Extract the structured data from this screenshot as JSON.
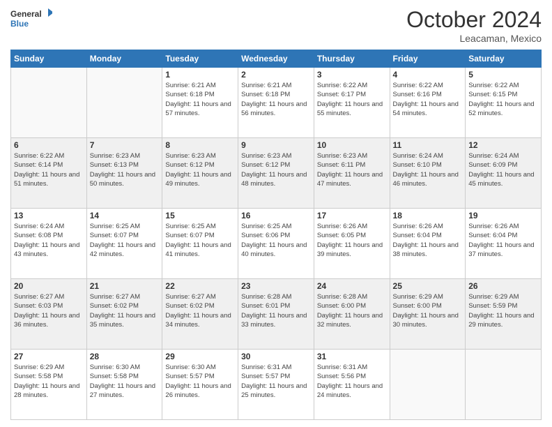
{
  "header": {
    "logo_line1": "General",
    "logo_line2": "Blue",
    "month_title": "October 2024",
    "location": "Leacaman, Mexico"
  },
  "days_of_week": [
    "Sunday",
    "Monday",
    "Tuesday",
    "Wednesday",
    "Thursday",
    "Friday",
    "Saturday"
  ],
  "weeks": [
    [
      {
        "day": "",
        "info": ""
      },
      {
        "day": "",
        "info": ""
      },
      {
        "day": "1",
        "info": "Sunrise: 6:21 AM\nSunset: 6:18 PM\nDaylight: 11 hours and 57 minutes."
      },
      {
        "day": "2",
        "info": "Sunrise: 6:21 AM\nSunset: 6:18 PM\nDaylight: 11 hours and 56 minutes."
      },
      {
        "day": "3",
        "info": "Sunrise: 6:22 AM\nSunset: 6:17 PM\nDaylight: 11 hours and 55 minutes."
      },
      {
        "day": "4",
        "info": "Sunrise: 6:22 AM\nSunset: 6:16 PM\nDaylight: 11 hours and 54 minutes."
      },
      {
        "day": "5",
        "info": "Sunrise: 6:22 AM\nSunset: 6:15 PM\nDaylight: 11 hours and 52 minutes."
      }
    ],
    [
      {
        "day": "6",
        "info": "Sunrise: 6:22 AM\nSunset: 6:14 PM\nDaylight: 11 hours and 51 minutes."
      },
      {
        "day": "7",
        "info": "Sunrise: 6:23 AM\nSunset: 6:13 PM\nDaylight: 11 hours and 50 minutes."
      },
      {
        "day": "8",
        "info": "Sunrise: 6:23 AM\nSunset: 6:12 PM\nDaylight: 11 hours and 49 minutes."
      },
      {
        "day": "9",
        "info": "Sunrise: 6:23 AM\nSunset: 6:12 PM\nDaylight: 11 hours and 48 minutes."
      },
      {
        "day": "10",
        "info": "Sunrise: 6:23 AM\nSunset: 6:11 PM\nDaylight: 11 hours and 47 minutes."
      },
      {
        "day": "11",
        "info": "Sunrise: 6:24 AM\nSunset: 6:10 PM\nDaylight: 11 hours and 46 minutes."
      },
      {
        "day": "12",
        "info": "Sunrise: 6:24 AM\nSunset: 6:09 PM\nDaylight: 11 hours and 45 minutes."
      }
    ],
    [
      {
        "day": "13",
        "info": "Sunrise: 6:24 AM\nSunset: 6:08 PM\nDaylight: 11 hours and 43 minutes."
      },
      {
        "day": "14",
        "info": "Sunrise: 6:25 AM\nSunset: 6:07 PM\nDaylight: 11 hours and 42 minutes."
      },
      {
        "day": "15",
        "info": "Sunrise: 6:25 AM\nSunset: 6:07 PM\nDaylight: 11 hours and 41 minutes."
      },
      {
        "day": "16",
        "info": "Sunrise: 6:25 AM\nSunset: 6:06 PM\nDaylight: 11 hours and 40 minutes."
      },
      {
        "day": "17",
        "info": "Sunrise: 6:26 AM\nSunset: 6:05 PM\nDaylight: 11 hours and 39 minutes."
      },
      {
        "day": "18",
        "info": "Sunrise: 6:26 AM\nSunset: 6:04 PM\nDaylight: 11 hours and 38 minutes."
      },
      {
        "day": "19",
        "info": "Sunrise: 6:26 AM\nSunset: 6:04 PM\nDaylight: 11 hours and 37 minutes."
      }
    ],
    [
      {
        "day": "20",
        "info": "Sunrise: 6:27 AM\nSunset: 6:03 PM\nDaylight: 11 hours and 36 minutes."
      },
      {
        "day": "21",
        "info": "Sunrise: 6:27 AM\nSunset: 6:02 PM\nDaylight: 11 hours and 35 minutes."
      },
      {
        "day": "22",
        "info": "Sunrise: 6:27 AM\nSunset: 6:02 PM\nDaylight: 11 hours and 34 minutes."
      },
      {
        "day": "23",
        "info": "Sunrise: 6:28 AM\nSunset: 6:01 PM\nDaylight: 11 hours and 33 minutes."
      },
      {
        "day": "24",
        "info": "Sunrise: 6:28 AM\nSunset: 6:00 PM\nDaylight: 11 hours and 32 minutes."
      },
      {
        "day": "25",
        "info": "Sunrise: 6:29 AM\nSunset: 6:00 PM\nDaylight: 11 hours and 30 minutes."
      },
      {
        "day": "26",
        "info": "Sunrise: 6:29 AM\nSunset: 5:59 PM\nDaylight: 11 hours and 29 minutes."
      }
    ],
    [
      {
        "day": "27",
        "info": "Sunrise: 6:29 AM\nSunset: 5:58 PM\nDaylight: 11 hours and 28 minutes."
      },
      {
        "day": "28",
        "info": "Sunrise: 6:30 AM\nSunset: 5:58 PM\nDaylight: 11 hours and 27 minutes."
      },
      {
        "day": "29",
        "info": "Sunrise: 6:30 AM\nSunset: 5:57 PM\nDaylight: 11 hours and 26 minutes."
      },
      {
        "day": "30",
        "info": "Sunrise: 6:31 AM\nSunset: 5:57 PM\nDaylight: 11 hours and 25 minutes."
      },
      {
        "day": "31",
        "info": "Sunrise: 6:31 AM\nSunset: 5:56 PM\nDaylight: 11 hours and 24 minutes."
      },
      {
        "day": "",
        "info": ""
      },
      {
        "day": "",
        "info": ""
      }
    ]
  ]
}
